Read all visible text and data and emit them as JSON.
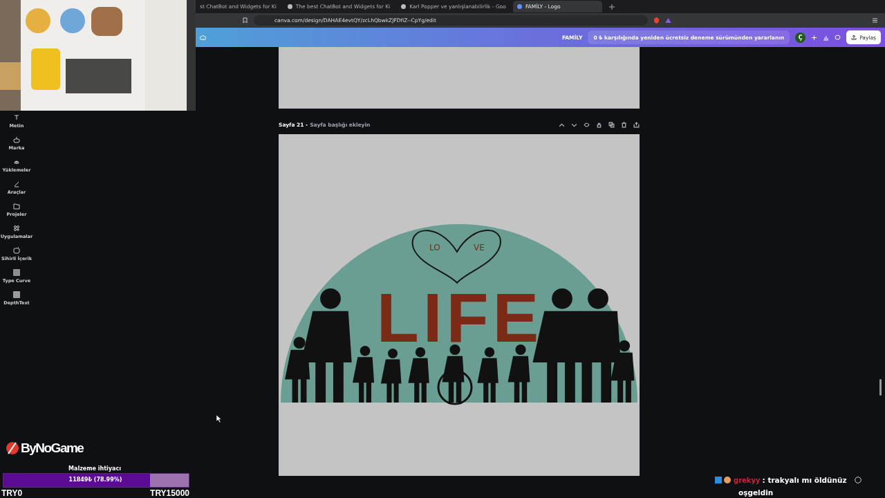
{
  "browser": {
    "tabs": [
      {
        "title": "st ChatBot and Widgets for Ki",
        "selected": false
      },
      {
        "title": "The best ChatBot and Widgets for Ki",
        "selected": false
      },
      {
        "title": "Karl Popper ve yanlışlanabilirlik - Goo",
        "selected": false
      },
      {
        "title": "FAMİLY - Logo",
        "selected": true
      }
    ],
    "url": "canva.com/design/DAHAE4evtQY/zcLhQbwkZJFDfiZ--CpYg/edit"
  },
  "header": {
    "design_name": "FAMİLY",
    "promo": "0 ₺ karşılığında yeniden ücretsiz deneme sürümünden yararlanın",
    "avatar": "Ç",
    "share": "Paylaş"
  },
  "sidebar": {
    "items": [
      {
        "label": "Metin"
      },
      {
        "label": "Marka"
      },
      {
        "label": "Yüklemeler"
      },
      {
        "label": "Araçlar"
      },
      {
        "label": "Projeler"
      },
      {
        "label": "Uygulamalar"
      },
      {
        "label": "Sihirli İçerik"
      },
      {
        "label": "Type Curve"
      },
      {
        "label": "DepthText"
      }
    ]
  },
  "page": {
    "number": "Sayfa 21 -",
    "title_placeholder": "Sayfa başlığı ekleyin"
  },
  "design": {
    "heart_left": "LO",
    "heart_right": "VE",
    "word": "LIFE"
  },
  "overlay": {
    "sponsor": "ByNoGame",
    "goal": {
      "title": "Malzeme ihtiyacı",
      "reading": "11849₺ (78.99%)",
      "level": 0.7899,
      "min": "TRY0",
      "max": "TRY15000"
    },
    "chat": {
      "user": "grekyy",
      "message": ": trakyalı mı öldünüz",
      "next": "oşgeldin"
    }
  }
}
